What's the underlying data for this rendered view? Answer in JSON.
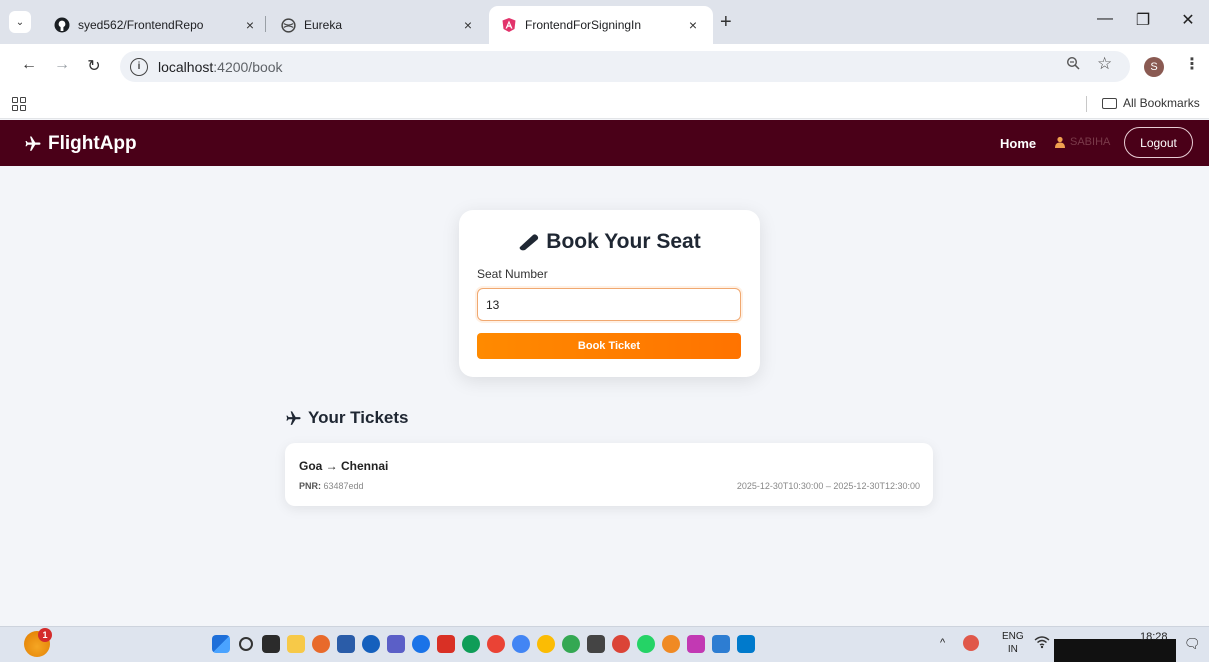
{
  "browser": {
    "tabs": [
      {
        "label": "syed562/FrontendRepo",
        "favicon": "github-icon",
        "close": "×"
      },
      {
        "label": "Eureka",
        "favicon": "globe-icon",
        "close": "×"
      },
      {
        "label": "FrontendForSigningIn",
        "favicon": "angular-icon",
        "close": "×",
        "active": true
      }
    ],
    "new_tab": "+",
    "url_host": "localhost",
    "url_path": ":4200/book",
    "profile_initial": "S",
    "bookmarks_label": "All Bookmarks"
  },
  "app": {
    "brand": "FlightApp",
    "nav": {
      "home": "Home",
      "user": "SABIHA",
      "logout": "Logout"
    },
    "booking": {
      "title": "Book Your Seat",
      "seat_label": "Seat Number",
      "seat_value": "13",
      "button": "Book Ticket"
    },
    "tickets_title": "Your Tickets",
    "tickets": [
      {
        "route": "Goa → Chennai",
        "pnr_label": "PNR:",
        "pnr": "63487edd",
        "times": "2025-12-30T10:30:00 – 2025-12-30T12:30:00"
      }
    ],
    "colors": {
      "nav_bg": "#4a0018",
      "accent": "#ff8000"
    }
  },
  "taskbar": {
    "notification_count": "1",
    "lang_top": "ENG",
    "lang_bottom": "IN",
    "time": "18:28"
  }
}
